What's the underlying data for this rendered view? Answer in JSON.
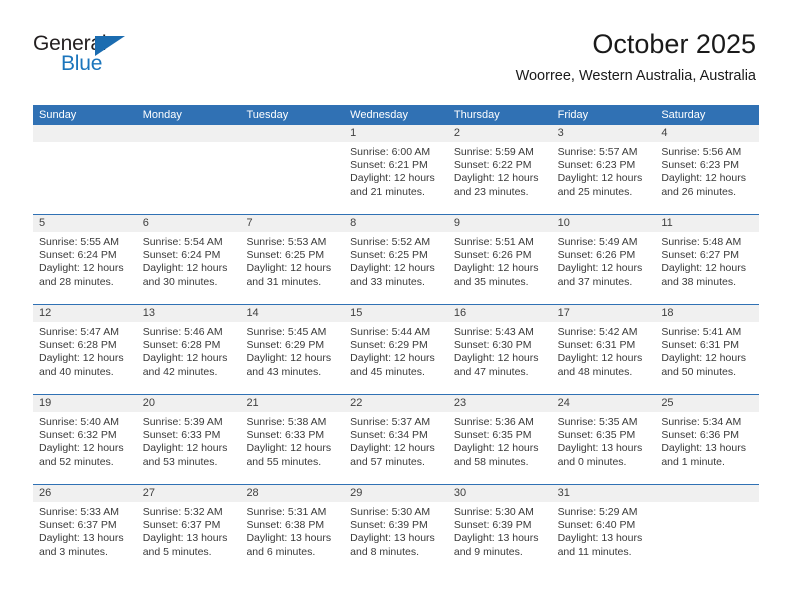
{
  "brand": {
    "name_part1": "General",
    "name_part2": "Blue",
    "accent_color": "#1b75bc",
    "triangle_color": "#1b6cb0"
  },
  "header": {
    "title": "October 2025",
    "subtitle": "Woorree, Western Australia, Australia",
    "header_bg": "#3071b4",
    "daynum_bg": "#f0f0f0"
  },
  "weekdays": [
    "Sunday",
    "Monday",
    "Tuesday",
    "Wednesday",
    "Thursday",
    "Friday",
    "Saturday"
  ],
  "labels": {
    "sunrise": "Sunrise:",
    "sunset": "Sunset:",
    "daylight": "Daylight:"
  },
  "weeks": [
    [
      {
        "day": "",
        "sunrise": "",
        "sunset": "",
        "daylight_line1": "",
        "daylight_line2": ""
      },
      {
        "day": "",
        "sunrise": "",
        "sunset": "",
        "daylight_line1": "",
        "daylight_line2": ""
      },
      {
        "day": "",
        "sunrise": "",
        "sunset": "",
        "daylight_line1": "",
        "daylight_line2": ""
      },
      {
        "day": "1",
        "sunrise": "Sunrise: 6:00 AM",
        "sunset": "Sunset: 6:21 PM",
        "daylight_line1": "Daylight: 12 hours",
        "daylight_line2": "and 21 minutes."
      },
      {
        "day": "2",
        "sunrise": "Sunrise: 5:59 AM",
        "sunset": "Sunset: 6:22 PM",
        "daylight_line1": "Daylight: 12 hours",
        "daylight_line2": "and 23 minutes."
      },
      {
        "day": "3",
        "sunrise": "Sunrise: 5:57 AM",
        "sunset": "Sunset: 6:23 PM",
        "daylight_line1": "Daylight: 12 hours",
        "daylight_line2": "and 25 minutes."
      },
      {
        "day": "4",
        "sunrise": "Sunrise: 5:56 AM",
        "sunset": "Sunset: 6:23 PM",
        "daylight_line1": "Daylight: 12 hours",
        "daylight_line2": "and 26 minutes."
      }
    ],
    [
      {
        "day": "5",
        "sunrise": "Sunrise: 5:55 AM",
        "sunset": "Sunset: 6:24 PM",
        "daylight_line1": "Daylight: 12 hours",
        "daylight_line2": "and 28 minutes."
      },
      {
        "day": "6",
        "sunrise": "Sunrise: 5:54 AM",
        "sunset": "Sunset: 6:24 PM",
        "daylight_line1": "Daylight: 12 hours",
        "daylight_line2": "and 30 minutes."
      },
      {
        "day": "7",
        "sunrise": "Sunrise: 5:53 AM",
        "sunset": "Sunset: 6:25 PM",
        "daylight_line1": "Daylight: 12 hours",
        "daylight_line2": "and 31 minutes."
      },
      {
        "day": "8",
        "sunrise": "Sunrise: 5:52 AM",
        "sunset": "Sunset: 6:25 PM",
        "daylight_line1": "Daylight: 12 hours",
        "daylight_line2": "and 33 minutes."
      },
      {
        "day": "9",
        "sunrise": "Sunrise: 5:51 AM",
        "sunset": "Sunset: 6:26 PM",
        "daylight_line1": "Daylight: 12 hours",
        "daylight_line2": "and 35 minutes."
      },
      {
        "day": "10",
        "sunrise": "Sunrise: 5:49 AM",
        "sunset": "Sunset: 6:26 PM",
        "daylight_line1": "Daylight: 12 hours",
        "daylight_line2": "and 37 minutes."
      },
      {
        "day": "11",
        "sunrise": "Sunrise: 5:48 AM",
        "sunset": "Sunset: 6:27 PM",
        "daylight_line1": "Daylight: 12 hours",
        "daylight_line2": "and 38 minutes."
      }
    ],
    [
      {
        "day": "12",
        "sunrise": "Sunrise: 5:47 AM",
        "sunset": "Sunset: 6:28 PM",
        "daylight_line1": "Daylight: 12 hours",
        "daylight_line2": "and 40 minutes."
      },
      {
        "day": "13",
        "sunrise": "Sunrise: 5:46 AM",
        "sunset": "Sunset: 6:28 PM",
        "daylight_line1": "Daylight: 12 hours",
        "daylight_line2": "and 42 minutes."
      },
      {
        "day": "14",
        "sunrise": "Sunrise: 5:45 AM",
        "sunset": "Sunset: 6:29 PM",
        "daylight_line1": "Daylight: 12 hours",
        "daylight_line2": "and 43 minutes."
      },
      {
        "day": "15",
        "sunrise": "Sunrise: 5:44 AM",
        "sunset": "Sunset: 6:29 PM",
        "daylight_line1": "Daylight: 12 hours",
        "daylight_line2": "and 45 minutes."
      },
      {
        "day": "16",
        "sunrise": "Sunrise: 5:43 AM",
        "sunset": "Sunset: 6:30 PM",
        "daylight_line1": "Daylight: 12 hours",
        "daylight_line2": "and 47 minutes."
      },
      {
        "day": "17",
        "sunrise": "Sunrise: 5:42 AM",
        "sunset": "Sunset: 6:31 PM",
        "daylight_line1": "Daylight: 12 hours",
        "daylight_line2": "and 48 minutes."
      },
      {
        "day": "18",
        "sunrise": "Sunrise: 5:41 AM",
        "sunset": "Sunset: 6:31 PM",
        "daylight_line1": "Daylight: 12 hours",
        "daylight_line2": "and 50 minutes."
      }
    ],
    [
      {
        "day": "19",
        "sunrise": "Sunrise: 5:40 AM",
        "sunset": "Sunset: 6:32 PM",
        "daylight_line1": "Daylight: 12 hours",
        "daylight_line2": "and 52 minutes."
      },
      {
        "day": "20",
        "sunrise": "Sunrise: 5:39 AM",
        "sunset": "Sunset: 6:33 PM",
        "daylight_line1": "Daylight: 12 hours",
        "daylight_line2": "and 53 minutes."
      },
      {
        "day": "21",
        "sunrise": "Sunrise: 5:38 AM",
        "sunset": "Sunset: 6:33 PM",
        "daylight_line1": "Daylight: 12 hours",
        "daylight_line2": "and 55 minutes."
      },
      {
        "day": "22",
        "sunrise": "Sunrise: 5:37 AM",
        "sunset": "Sunset: 6:34 PM",
        "daylight_line1": "Daylight: 12 hours",
        "daylight_line2": "and 57 minutes."
      },
      {
        "day": "23",
        "sunrise": "Sunrise: 5:36 AM",
        "sunset": "Sunset: 6:35 PM",
        "daylight_line1": "Daylight: 12 hours",
        "daylight_line2": "and 58 minutes."
      },
      {
        "day": "24",
        "sunrise": "Sunrise: 5:35 AM",
        "sunset": "Sunset: 6:35 PM",
        "daylight_line1": "Daylight: 13 hours",
        "daylight_line2": "and 0 minutes."
      },
      {
        "day": "25",
        "sunrise": "Sunrise: 5:34 AM",
        "sunset": "Sunset: 6:36 PM",
        "daylight_line1": "Daylight: 13 hours",
        "daylight_line2": "and 1 minute."
      }
    ],
    [
      {
        "day": "26",
        "sunrise": "Sunrise: 5:33 AM",
        "sunset": "Sunset: 6:37 PM",
        "daylight_line1": "Daylight: 13 hours",
        "daylight_line2": "and 3 minutes."
      },
      {
        "day": "27",
        "sunrise": "Sunrise: 5:32 AM",
        "sunset": "Sunset: 6:37 PM",
        "daylight_line1": "Daylight: 13 hours",
        "daylight_line2": "and 5 minutes."
      },
      {
        "day": "28",
        "sunrise": "Sunrise: 5:31 AM",
        "sunset": "Sunset: 6:38 PM",
        "daylight_line1": "Daylight: 13 hours",
        "daylight_line2": "and 6 minutes."
      },
      {
        "day": "29",
        "sunrise": "Sunrise: 5:30 AM",
        "sunset": "Sunset: 6:39 PM",
        "daylight_line1": "Daylight: 13 hours",
        "daylight_line2": "and 8 minutes."
      },
      {
        "day": "30",
        "sunrise": "Sunrise: 5:30 AM",
        "sunset": "Sunset: 6:39 PM",
        "daylight_line1": "Daylight: 13 hours",
        "daylight_line2": "and 9 minutes."
      },
      {
        "day": "31",
        "sunrise": "Sunrise: 5:29 AM",
        "sunset": "Sunset: 6:40 PM",
        "daylight_line1": "Daylight: 13 hours",
        "daylight_line2": "and 11 minutes."
      },
      {
        "day": "",
        "sunrise": "",
        "sunset": "",
        "daylight_line1": "",
        "daylight_line2": ""
      }
    ]
  ]
}
